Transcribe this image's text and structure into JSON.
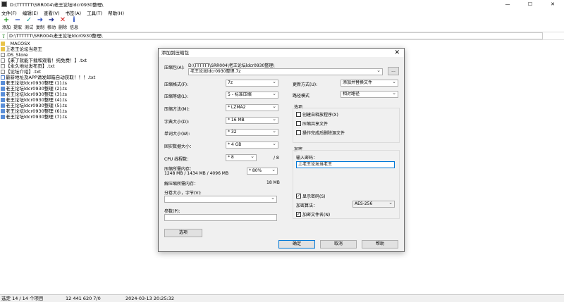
{
  "window": {
    "title": "D:\\TTTTTT\\SRR004\\老王论坛ldcr0930整理\\",
    "controls": [
      "—",
      "☐",
      "✕"
    ]
  },
  "menu": [
    "文件(F)",
    "编辑(E)",
    "查看(V)",
    "书签(A)",
    "工具(T)",
    "帮助(H)"
  ],
  "toolbar": [
    {
      "label": "添加",
      "icon": "plus-icon",
      "color": "#1a9b1a",
      "glyph": "+"
    },
    {
      "label": "提取",
      "icon": "minus-icon",
      "color": "#2a4fbf",
      "glyph": "−"
    },
    {
      "label": "测试",
      "icon": "check-icon",
      "color": "#1aa39b",
      "glyph": "✓"
    },
    {
      "label": "复制",
      "icon": "copy-arrow-icon",
      "color": "#2a4fbf",
      "glyph": "➜"
    },
    {
      "label": "移动",
      "icon": "move-arrow-icon",
      "color": "#1a2a8b",
      "glyph": "➜"
    },
    {
      "label": "删除",
      "icon": "delete-icon",
      "color": "#d01818",
      "glyph": "✕"
    },
    {
      "label": "信息",
      "icon": "info-icon",
      "color": "#2a4fbf",
      "glyph": "i"
    }
  ],
  "address": "D:\\TTTTTT\\SRR004\\老王论坛ldcr0930整理\\",
  "files": [
    {
      "name": "__MACOSX",
      "type": "folder"
    },
    {
      "name": "上老王论坛当老王",
      "type": "folder"
    },
    {
      "name": ".DS_Store",
      "type": "file"
    },
    {
      "name": "【来了就能下载和观看！纯免费！】.txt",
      "type": "file"
    },
    {
      "name": "【永久地址发布页】.txt",
      "type": "file"
    },
    {
      "name": "【论坛介绍】.txt",
      "type": "file"
    },
    {
      "name": "最新地址及APP请发邮箱自动获取！！！.txt",
      "type": "url"
    },
    {
      "name": "老王论坛ldcr0930整理 (1).ts",
      "type": "ts"
    },
    {
      "name": "老王论坛ldcr0930整理 (2).ts",
      "type": "ts"
    },
    {
      "name": "老王论坛ldcr0930整理 (3).ts",
      "type": "ts"
    },
    {
      "name": "老王论坛ldcr0930整理 (4).ts",
      "type": "ts"
    },
    {
      "name": "老王论坛ldcr0930整理 (5).ts",
      "type": "ts"
    },
    {
      "name": "老王论坛ldcr0930整理 (6).ts",
      "type": "ts"
    },
    {
      "name": "老王论坛ldcr0930整理 (7).ts",
      "type": "ts"
    }
  ],
  "status": {
    "selection": "选定 14 / 14 个项目",
    "size": "12 441 620 7/0",
    "date": "2024-03-13 20:25:32"
  },
  "dialog": {
    "title": "添加到压缩包",
    "archive_label": "压缩包(A):",
    "archive_path": "D:\\TTTTTT\\SRR004\\老王论坛ldcr0930整理\\",
    "archive_name": "老王论坛ldcr0930整理.7z",
    "browse": "...",
    "format_label": "压缩格式(F):",
    "format_value": "7z",
    "level_label": "压缩等级(L):",
    "level_value": "5 - 标准压缩",
    "method_label": "压缩方法(M):",
    "method_value": "* LZMA2",
    "dict_label": "字典大小(D):",
    "dict_value": "* 16 MB",
    "word_label": "单词大小(W):",
    "word_value": "* 32",
    "solid_label": "固实数据大小：",
    "solid_value": "* 4 GB",
    "cpu_label": "CPU 线程数：",
    "cpu_value": "* 8",
    "cpu_total": "/ 8",
    "mem_label": "压缩所需内存：",
    "mem_value": "1248 MB / 1434 MB / 4096 MB",
    "mem_pct": "* 80%",
    "decomp_label": "解压缩所需内存：",
    "decomp_value": "18 MB",
    "split_label": "分卷大小，字节(V):",
    "params_label": "参数(P):",
    "options_btn": "选项",
    "update_label": "更新方式(U):",
    "update_value": "添加并替换文件",
    "pathmode_label": "路径模式",
    "pathmode_value": "相对路径",
    "options_group": "选项",
    "opt_sfx": "创建自释放程序(X)",
    "opt_shared": "压缩共享文件",
    "opt_delete": "操作完成后删除源文件",
    "encrypt_group": "加密",
    "password_label": "输入密码：",
    "password_value": "上老王论坛当老王",
    "show_password": "显示密码(S)",
    "enc_method_label": "加密算法：",
    "enc_method_value": "AES-256",
    "enc_names": "加密文件名(N)",
    "ok": "确定",
    "cancel": "取消",
    "help": "帮助"
  }
}
